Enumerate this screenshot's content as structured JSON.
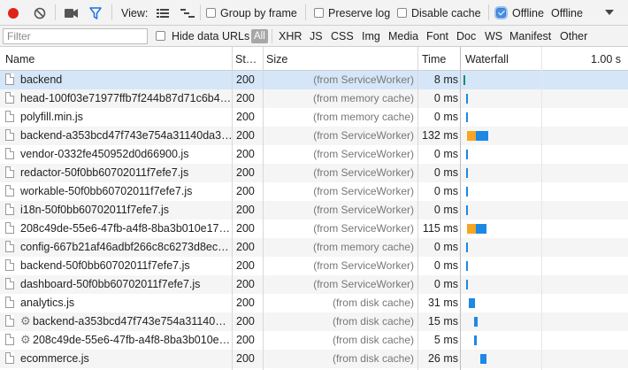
{
  "toolbar": {
    "view_label": "View:",
    "group_by_frame": {
      "label": "Group by frame",
      "checked": false
    },
    "preserve_log": {
      "label": "Preserve log",
      "checked": false
    },
    "disable_cache": {
      "label": "Disable cache",
      "checked": false
    },
    "offline": {
      "label": "Offline",
      "checked": true
    },
    "throttle": {
      "value": "Offline"
    },
    "icons": [
      "record-icon",
      "clear-icon",
      "camera-icon",
      "filter-icon",
      "list-view-icon",
      "waterfall-view-icon",
      "dropdown-arrow-icon"
    ]
  },
  "filterbar": {
    "filter_placeholder": "Filter",
    "hide_data_urls": {
      "label": "Hide data URLs",
      "checked": false
    },
    "types": [
      "All",
      "XHR",
      "JS",
      "CSS",
      "Img",
      "Media",
      "Font",
      "Doc",
      "WS",
      "Manifest",
      "Other"
    ],
    "active_type": "All"
  },
  "columns": {
    "name": "Name",
    "status": "St…",
    "size": "Size",
    "time": "Time",
    "waterfall": "Waterfall",
    "scale_label": "1.00 s"
  },
  "colors": {
    "selected_row": "#d6e6f9",
    "waiting": "#f5a623",
    "download": "#1e88e5",
    "record": "#e0231a"
  },
  "rows": [
    {
      "name": "backend",
      "status": "200",
      "size": "(from ServiceWorker)",
      "time": "8 ms",
      "selected": true,
      "gear": false
    },
    {
      "name": "head-100f03e71977ffb7f244b87d71c6b4…",
      "status": "200",
      "size": "(from memory cache)",
      "time": "0 ms",
      "gear": false
    },
    {
      "name": "polyfill.min.js",
      "status": "200",
      "size": "(from memory cache)",
      "time": "0 ms",
      "gear": false
    },
    {
      "name": "backend-a353bcd47f743e754a31140da3…",
      "status": "200",
      "size": "(from ServiceWorker)",
      "time": "132 ms",
      "gear": false
    },
    {
      "name": "vendor-0332fe450952d0d66900.js",
      "status": "200",
      "size": "(from ServiceWorker)",
      "time": "0 ms",
      "gear": false
    },
    {
      "name": "redactor-50f0bb60702011f7efe7.js",
      "status": "200",
      "size": "(from ServiceWorker)",
      "time": "0 ms",
      "gear": false
    },
    {
      "name": "workable-50f0bb60702011f7efe7.js",
      "status": "200",
      "size": "(from ServiceWorker)",
      "time": "0 ms",
      "gear": false
    },
    {
      "name": "i18n-50f0bb60702011f7efe7.js",
      "status": "200",
      "size": "(from ServiceWorker)",
      "time": "0 ms",
      "gear": false
    },
    {
      "name": "208c49de-55e6-47fb-a4f8-8ba3b010e17…",
      "status": "200",
      "size": "(from ServiceWorker)",
      "time": "115 ms",
      "gear": false
    },
    {
      "name": "config-667b21af46adbf266c8c6273d8ec…",
      "status": "200",
      "size": "(from memory cache)",
      "time": "0 ms",
      "gear": false
    },
    {
      "name": "backend-50f0bb60702011f7efe7.js",
      "status": "200",
      "size": "(from ServiceWorker)",
      "time": "0 ms",
      "gear": false
    },
    {
      "name": "dashboard-50f0bb60702011f7efe7.js",
      "status": "200",
      "size": "(from ServiceWorker)",
      "time": "0 ms",
      "gear": false
    },
    {
      "name": "analytics.js",
      "status": "200",
      "size": "(from disk cache)",
      "time": "31 ms",
      "gear": false
    },
    {
      "name": "backend-a353bcd47f743e754a31140…",
      "status": "200",
      "size": "(from disk cache)",
      "time": "15 ms",
      "gear": true
    },
    {
      "name": "208c49de-55e6-47fb-a4f8-8ba3b010e…",
      "status": "200",
      "size": "(from disk cache)",
      "time": "5 ms",
      "gear": true
    },
    {
      "name": "ecommerce.js",
      "status": "200",
      "size": "(from disk cache)",
      "time": "26 ms",
      "gear": false
    }
  ]
}
